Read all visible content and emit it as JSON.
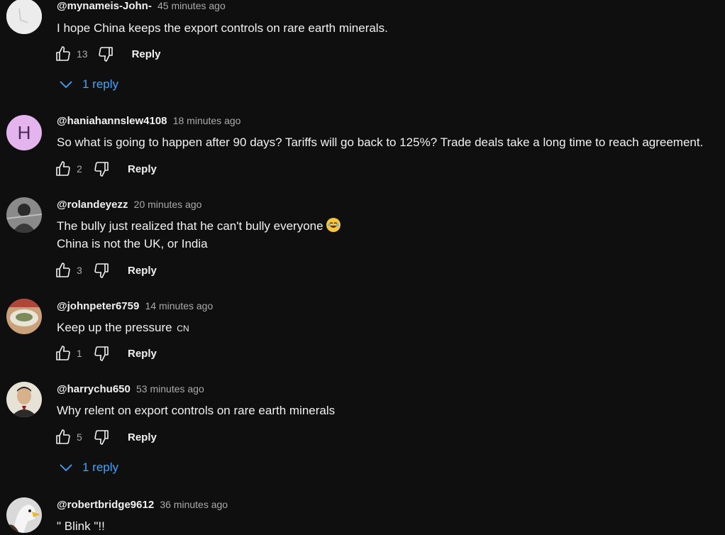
{
  "comments": [
    {
      "author": "@mynameis-John-",
      "time": "45 minutes ago",
      "lines": [
        "I hope China keeps the export controls on rare earth minerals."
      ],
      "likes": "13",
      "reply_label": "Reply",
      "replies_label": "1 reply"
    },
    {
      "author": "@haniahannslew4108",
      "time": "18 minutes ago",
      "avatar_letter": "H",
      "lines": [
        "So what is going to happen after 90 days?  Tariffs will go back to 125%?  Trade deals take a long time to reach agreement."
      ],
      "likes": "2",
      "reply_label": "Reply"
    },
    {
      "author": "@rolandeyezz",
      "time": "20 minutes ago",
      "lines": [
        "The bully just realized that he can't bully everyone",
        "China is not the UK, or India"
      ],
      "likes": "3",
      "reply_label": "Reply"
    },
    {
      "author": "@johnpeter6759",
      "time": "14 minutes ago",
      "lines": [
        "Keep up the pressure"
      ],
      "flag_text": "CN",
      "likes": "1",
      "reply_label": "Reply"
    },
    {
      "author": "@harrychu650",
      "time": "53 minutes ago",
      "lines": [
        "Why relent on export controls on rare earth minerals"
      ],
      "likes": "5",
      "reply_label": "Reply",
      "replies_label": "1 reply"
    },
    {
      "author": "@robertbridge9612",
      "time": "36 minutes ago",
      "lines": [
        "\" Blink \"!!"
      ]
    }
  ],
  "colors": {
    "background": "#0f0f0f",
    "link_blue": "#3ea6ff",
    "secondary_text": "#aaaaaa"
  }
}
